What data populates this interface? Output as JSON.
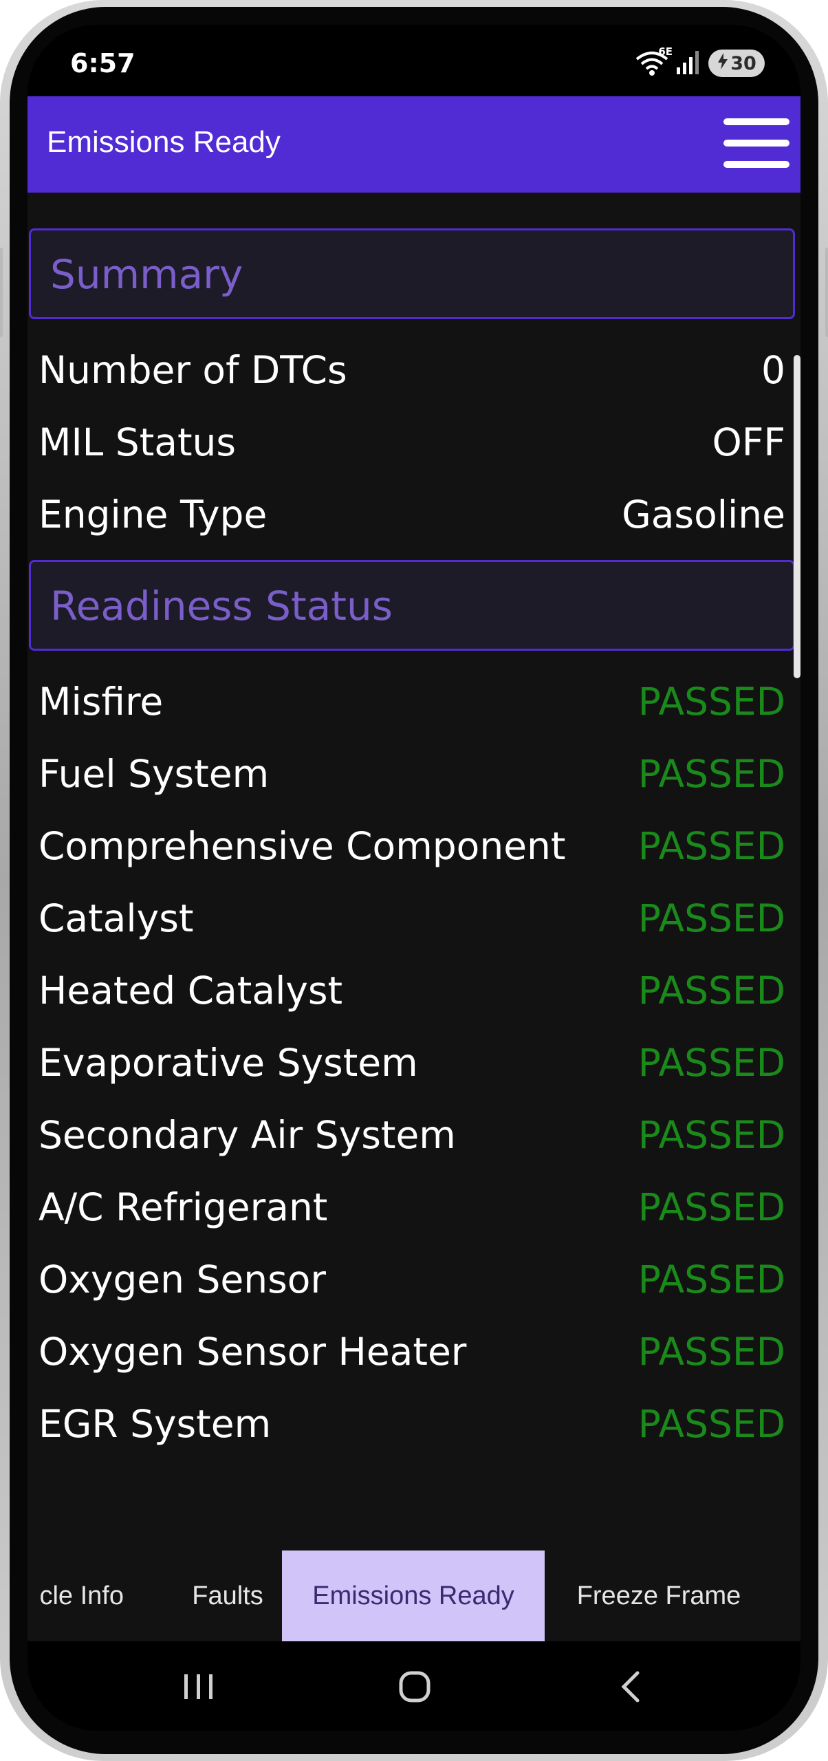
{
  "status_bar": {
    "time": "6:57",
    "network_label": "6E",
    "battery_level": "30"
  },
  "app_bar": {
    "title": "Emissions Ready",
    "menu_icon": "hamburger-menu-icon"
  },
  "summary": {
    "title": "Summary",
    "rows": [
      {
        "label": "Number of DTCs",
        "value": "0"
      },
      {
        "label": "MIL Status",
        "value": "OFF"
      },
      {
        "label": "Engine Type",
        "value": "Gasoline"
      }
    ]
  },
  "readiness": {
    "title": "Readiness Status",
    "rows": [
      {
        "label": "Misfire",
        "value": "PASSED"
      },
      {
        "label": "Fuel System",
        "value": "PASSED"
      },
      {
        "label": "Comprehensive Component",
        "value": "PASSED"
      },
      {
        "label": "Catalyst",
        "value": "PASSED"
      },
      {
        "label": "Heated Catalyst",
        "value": "PASSED"
      },
      {
        "label": "Evaporative System",
        "value": "PASSED"
      },
      {
        "label": "Secondary Air System",
        "value": "PASSED"
      },
      {
        "label": "A/C Refrigerant",
        "value": "PASSED"
      },
      {
        "label": "Oxygen Sensor",
        "value": "PASSED"
      },
      {
        "label": "Oxygen Sensor Heater",
        "value": "PASSED"
      },
      {
        "label": "EGR System",
        "value": "PASSED"
      }
    ]
  },
  "tabs": [
    {
      "label": "cle Info",
      "active": false
    },
    {
      "label": "Faults",
      "active": false
    },
    {
      "label": "Emissions Ready",
      "active": true
    },
    {
      "label": "Freeze Frame",
      "active": false
    }
  ],
  "nav_bar": {
    "recents_icon": "recents-icon",
    "home_icon": "home-icon",
    "back_icon": "back-icon"
  },
  "colors": {
    "primary": "#512bd4",
    "section_title": "#7a5ec9",
    "passed": "#1a8a1a",
    "active_tab": "#d1c4f8",
    "background": "#121212"
  }
}
